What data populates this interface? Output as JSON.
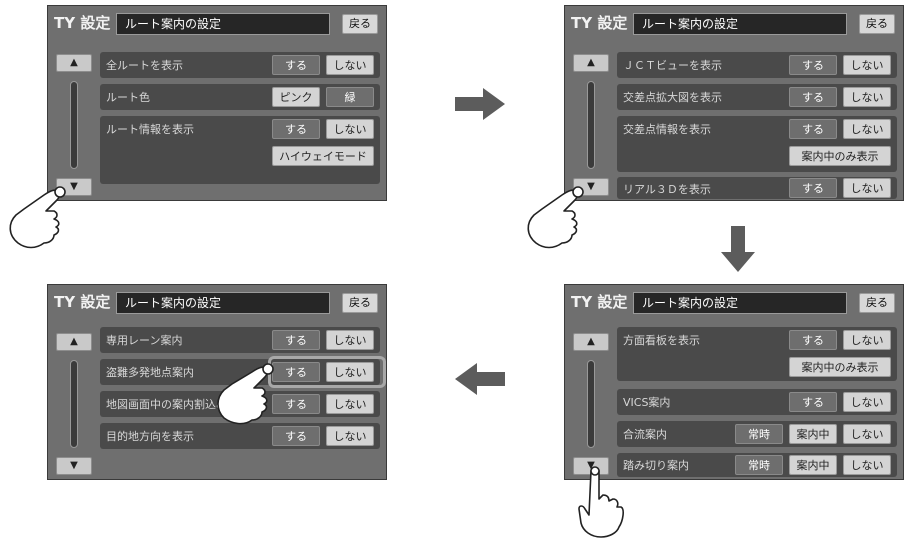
{
  "common": {
    "logo": "TY 設定",
    "title": "ルート案内の設定",
    "back_label": "戻る",
    "up_icon": "▲",
    "down_icon": "▼"
  },
  "screen1": {
    "rows": [
      {
        "label": "全ルートを表示",
        "buttons": [
          "する",
          "しない"
        ]
      },
      {
        "label": "ルート色",
        "buttons": [
          "ピンク",
          "緑"
        ]
      },
      {
        "label": "ルート情報を表示",
        "buttons": [
          "する",
          "しない",
          "ハイウェイモード"
        ]
      }
    ]
  },
  "screen2": {
    "rows": [
      {
        "label": "ＪＣＴビューを表示",
        "buttons": [
          "する",
          "しない"
        ]
      },
      {
        "label": "交差点拡大図を表示",
        "buttons": [
          "する",
          "しない"
        ]
      },
      {
        "label": "交差点情報を表示",
        "buttons": [
          "する",
          "しない",
          "案内中のみ表示"
        ]
      },
      {
        "label": "リアル３Ｄを表示",
        "buttons": [
          "する",
          "しない"
        ]
      }
    ]
  },
  "screen3": {
    "rows": [
      {
        "label": "方面看板を表示",
        "buttons": [
          "する",
          "しない",
          "案内中のみ表示"
        ]
      },
      {
        "label": "VICS案内",
        "buttons": [
          "する",
          "しない"
        ]
      },
      {
        "label": "合流案内",
        "buttons": [
          "常時",
          "案内中",
          "しない"
        ]
      },
      {
        "label": "踏み切り案内",
        "buttons": [
          "常時",
          "案内中",
          "しない"
        ]
      }
    ]
  },
  "screen4": {
    "rows": [
      {
        "label": "専用レーン案内",
        "buttons": [
          "する",
          "しない"
        ]
      },
      {
        "label": "盗難多発地点案内",
        "buttons": [
          "する",
          "しない"
        ]
      },
      {
        "label": "地図画面中の案内割込み",
        "buttons": [
          "する",
          "しない"
        ]
      },
      {
        "label": "目的地方向を表示",
        "buttons": [
          "する",
          "しない"
        ]
      }
    ]
  },
  "colors": {
    "active_button": "#6e6e6e",
    "inactive_button": "#d4d4d4",
    "arrow": "#5c5c5c"
  }
}
